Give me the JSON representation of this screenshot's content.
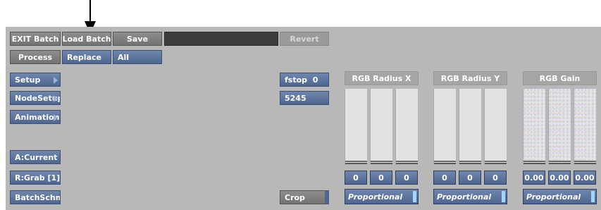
{
  "toolbar": {
    "exit_batch": "EXIT Batch",
    "load_batch": "Load Batch",
    "save": "Save",
    "revert": "Revert",
    "process": "Process",
    "replace": "Replace",
    "all": "All"
  },
  "sidebar": {
    "setup": "Setup",
    "node_setup": "NodeSetup",
    "animation": "Animation",
    "a_current": "A:Current",
    "r_grab": "R:Grab [1]",
    "batch_schm": "BatchSchm"
  },
  "controls": {
    "fstop_label": "fstop",
    "fstop_value": "0",
    "frame_number": "5245",
    "crop": "Crop"
  },
  "groups": [
    {
      "title": "RGB Radius X",
      "values": [
        "0",
        "0",
        "0"
      ],
      "mode": "Proportional"
    },
    {
      "title": "RGB Radius Y",
      "values": [
        "0",
        "0",
        "0"
      ],
      "mode": "Proportional"
    },
    {
      "title": "RGB Gain",
      "values": [
        "0.00",
        "0.00",
        "0.00"
      ],
      "mode": "Proportional"
    }
  ],
  "colors": {
    "panel": "#b8b8b8",
    "button_blue": "#5b719b",
    "button_grey": "#808080",
    "indicator": "#9fd8ff"
  }
}
